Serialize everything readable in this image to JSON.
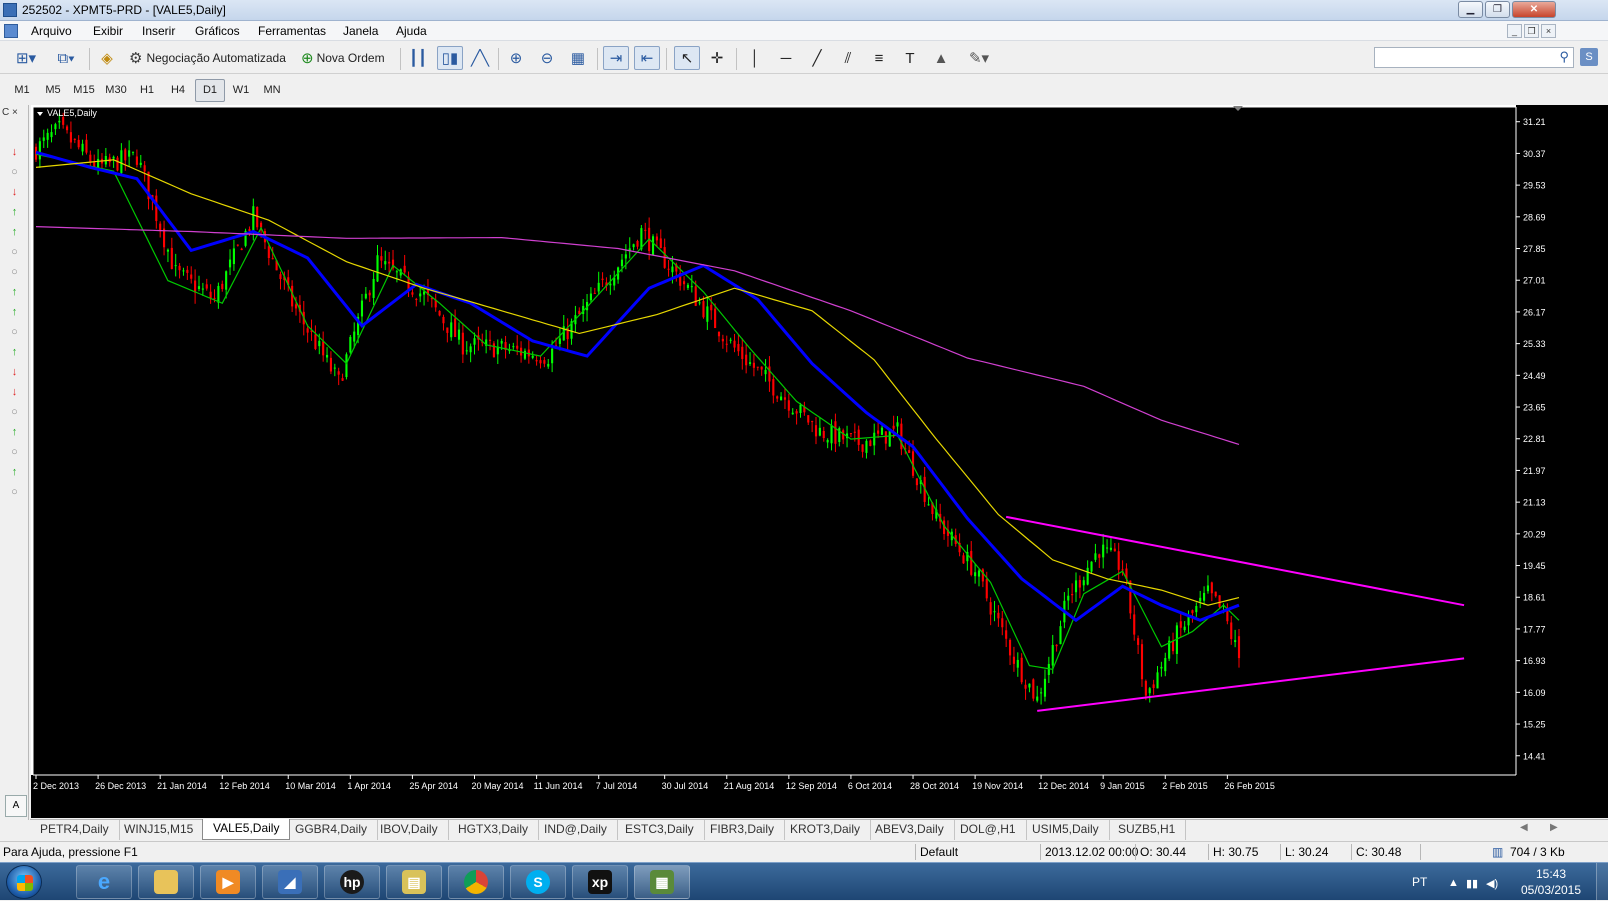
{
  "window": {
    "title": "252502 - XPMT5-PRD - [VALE5,Daily]"
  },
  "menu": [
    "Arquivo",
    "Exibir",
    "Inserir",
    "Gráficos",
    "Ferramentas",
    "Janela",
    "Ajuda"
  ],
  "toolbar": {
    "auto_trading_label": "Negociação Automatizada",
    "new_order_label": "Nova Ordem",
    "search_value": ""
  },
  "timeframes": {
    "items": [
      "M1",
      "M5",
      "M15",
      "M30",
      "H1",
      "H4",
      "D1",
      "W1",
      "MN"
    ],
    "active": "D1"
  },
  "left_panel": {
    "header": "C ×",
    "bottom_tab": "A"
  },
  "chart_data": {
    "type": "candlestick",
    "title": "VALE5,Daily",
    "symbol": "VALE5",
    "timeframe": "Daily",
    "background": "#000000",
    "colors": {
      "bull": "#00ff00",
      "bear": "#ff0000",
      "ma_fast": "#00c800",
      "ma_blue": "#0000ff",
      "ma_slow": "#e6d700",
      "ma_long": "#d040d0",
      "trendline": "#ff00ff",
      "axis_text": "#ffffff"
    },
    "ylim": [
      13.9,
      31.6
    ],
    "y_ticks": [
      "31.21",
      "30.37",
      "29.53",
      "28.69",
      "27.85",
      "27.01",
      "26.17",
      "25.33",
      "24.49",
      "23.65",
      "22.81",
      "21.97",
      "21.13",
      "20.29",
      "19.45",
      "18.61",
      "17.77",
      "16.93",
      "16.09",
      "15.25",
      "14.41"
    ],
    "x_ticks": [
      "2 Dec 2013",
      "26 Dec 2013",
      "21 Jan 2014",
      "12 Feb 2014",
      "10 Mar 2014",
      "1 Apr 2014",
      "25 Apr 2014",
      "20 May 2014",
      "11 Jun 2014",
      "7 Jul 2014",
      "30 Jul 2014",
      "21 Aug 2014",
      "12 Sep 2014",
      "6 Oct 2014",
      "28 Oct 2014",
      "19 Nov 2014",
      "12 Dec 2014",
      "9 Jan 2015",
      "2 Feb 2015",
      "26 Feb 2015"
    ],
    "total_bars": 311,
    "close_anchors": [
      [
        0,
        30.48
      ],
      [
        6,
        31.0
      ],
      [
        16,
        30.0
      ],
      [
        26,
        30.3
      ],
      [
        36,
        27.2
      ],
      [
        46,
        26.5
      ],
      [
        56,
        28.7
      ],
      [
        66,
        26.4
      ],
      [
        78,
        24.3
      ],
      [
        88,
        27.5
      ],
      [
        100,
        26.6
      ],
      [
        110,
        25.3
      ],
      [
        120,
        25.2
      ],
      [
        132,
        25.0
      ],
      [
        144,
        26.6
      ],
      [
        156,
        28.3
      ],
      [
        168,
        26.8
      ],
      [
        180,
        25.2
      ],
      [
        192,
        24.0
      ],
      [
        202,
        23.0
      ],
      [
        212,
        22.7
      ],
      [
        222,
        23.0
      ],
      [
        232,
        20.7
      ],
      [
        242,
        19.3
      ],
      [
        252,
        17.0
      ],
      [
        258,
        15.9
      ],
      [
        266,
        18.6
      ],
      [
        274,
        19.9
      ],
      [
        280,
        19.4
      ],
      [
        286,
        16.0
      ],
      [
        294,
        17.6
      ],
      [
        302,
        18.7
      ],
      [
        306,
        18.2
      ],
      [
        310,
        17.0
      ]
    ],
    "moving_averages": [
      {
        "name": "MA fast",
        "color": "#00c800",
        "points": [
          [
            0,
            30.35
          ],
          [
            20,
            29.9
          ],
          [
            34,
            27.0
          ],
          [
            48,
            26.4
          ],
          [
            58,
            28.4
          ],
          [
            70,
            25.8
          ],
          [
            80,
            24.8
          ],
          [
            92,
            27.4
          ],
          [
            104,
            26.4
          ],
          [
            116,
            25.3
          ],
          [
            130,
            25.0
          ],
          [
            142,
            26.3
          ],
          [
            158,
            28.1
          ],
          [
            172,
            26.7
          ],
          [
            184,
            25.2
          ],
          [
            196,
            23.8
          ],
          [
            210,
            22.8
          ],
          [
            222,
            22.9
          ],
          [
            234,
            20.5
          ],
          [
            246,
            19.0
          ],
          [
            256,
            16.8
          ],
          [
            262,
            16.7
          ],
          [
            270,
            18.7
          ],
          [
            280,
            19.3
          ],
          [
            290,
            17.3
          ],
          [
            298,
            17.7
          ],
          [
            306,
            18.4
          ],
          [
            310,
            18.0
          ]
        ]
      },
      {
        "name": "MA blue",
        "color": "#0000ff",
        "points": [
          [
            0,
            30.4
          ],
          [
            14,
            30.0
          ],
          [
            26,
            29.7
          ],
          [
            40,
            27.8
          ],
          [
            56,
            28.3
          ],
          [
            70,
            27.6
          ],
          [
            84,
            25.8
          ],
          [
            98,
            26.9
          ],
          [
            112,
            26.4
          ],
          [
            128,
            25.4
          ],
          [
            142,
            25.0
          ],
          [
            158,
            26.8
          ],
          [
            172,
            27.4
          ],
          [
            186,
            26.5
          ],
          [
            200,
            24.8
          ],
          [
            214,
            23.5
          ],
          [
            226,
            22.6
          ],
          [
            240,
            20.7
          ],
          [
            254,
            19.1
          ],
          [
            268,
            18.0
          ],
          [
            280,
            18.9
          ],
          [
            290,
            18.4
          ],
          [
            300,
            18.0
          ],
          [
            310,
            18.4
          ]
        ]
      },
      {
        "name": "MA slow",
        "color": "#e6d700",
        "points": [
          [
            0,
            30.0
          ],
          [
            20,
            30.2
          ],
          [
            40,
            29.3
          ],
          [
            60,
            28.6
          ],
          [
            80,
            27.5
          ],
          [
            100,
            26.8
          ],
          [
            120,
            26.2
          ],
          [
            140,
            25.6
          ],
          [
            160,
            26.1
          ],
          [
            180,
            26.8
          ],
          [
            200,
            26.2
          ],
          [
            216,
            24.9
          ],
          [
            232,
            22.8
          ],
          [
            248,
            20.8
          ],
          [
            262,
            19.6
          ],
          [
            276,
            19.1
          ],
          [
            290,
            18.8
          ],
          [
            302,
            18.4
          ],
          [
            310,
            18.6
          ]
        ]
      },
      {
        "name": "MA long",
        "color": "#d040d0",
        "points": [
          [
            0,
            28.43
          ],
          [
            40,
            28.3
          ],
          [
            80,
            28.12
          ],
          [
            120,
            28.14
          ],
          [
            150,
            27.85
          ],
          [
            180,
            27.26
          ],
          [
            210,
            26.2
          ],
          [
            240,
            24.95
          ],
          [
            270,
            24.2
          ],
          [
            290,
            23.3
          ],
          [
            310,
            22.66
          ]
        ]
      }
    ],
    "trendlines": [
      {
        "color": "#ff00ff",
        "from": [
          250,
          20.74
        ],
        "to": [
          368,
          18.4
        ]
      },
      {
        "color": "#ff00ff",
        "from": [
          258,
          15.6
        ],
        "to": [
          368,
          16.99
        ]
      }
    ],
    "last_bar": {
      "date": "2013.12.02 00:00",
      "open": "O: 30.44",
      "high": "H: 30.75",
      "low": "L: 30.24",
      "close": "C: 30.48"
    }
  },
  "tabs": {
    "items": [
      "PETR4,Daily",
      "WINJ15,M15",
      "VALE5,Daily",
      "GGBR4,Daily",
      "IBOV,Daily",
      "HGTX3,Daily",
      "IND@,Daily",
      "ESTC3,Daily",
      "FIBR3,Daily",
      "KROT3,Daily",
      "ABEV3,Daily",
      "DOL@,H1",
      "USIM5,Daily",
      "SUZB5,H1"
    ],
    "active": "VALE5,Daily"
  },
  "status": {
    "help": "Para Ajuda, pressione F1",
    "profile": "Default",
    "datetime": "2013.12.02 00:00",
    "open": "O: 30.44",
    "high": "H: 30.75",
    "low": "L: 30.24",
    "close": "C: 30.48",
    "traffic": "704 / 3 Kb"
  },
  "taskbar": {
    "lang": "PT",
    "time": "15:43",
    "date": "05/03/2015"
  }
}
